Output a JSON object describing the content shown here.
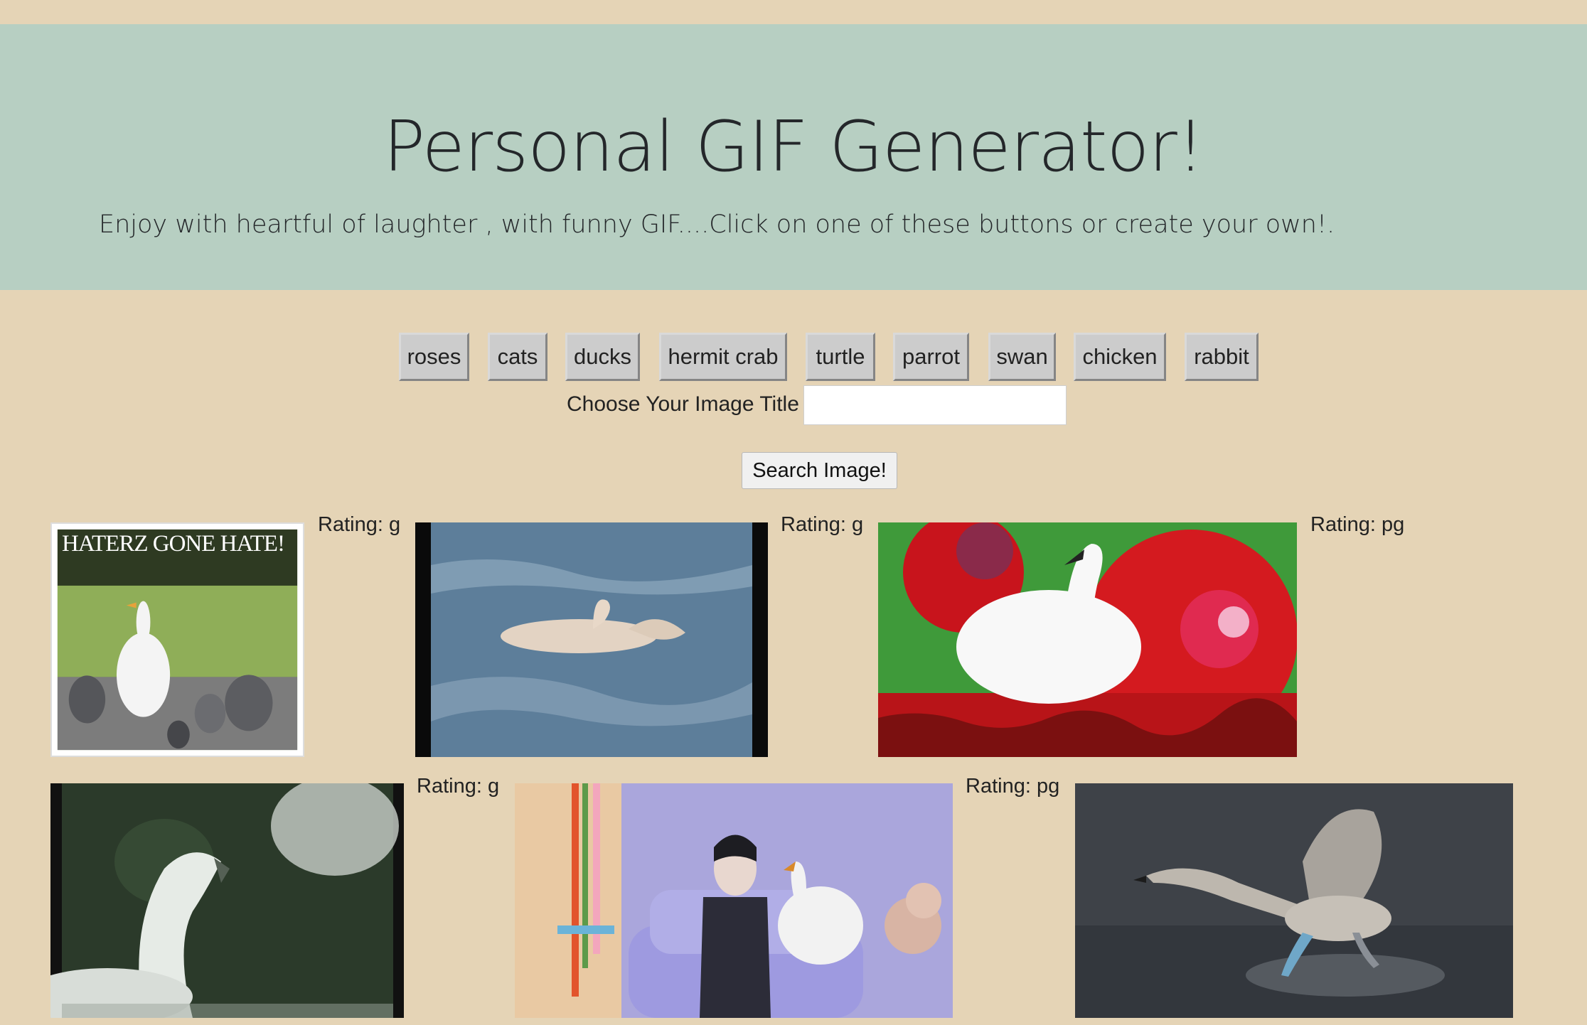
{
  "header": {
    "title": "Personal GIF Generator!",
    "subtitle": "Enjoy with heartful of laughter , with funny GIF....Click on one of these buttons or create your own!."
  },
  "topics": [
    "roses",
    "cats",
    "ducks",
    "hermit crab",
    "turtle",
    "parrot",
    "swan",
    "chicken",
    "rabbit"
  ],
  "form": {
    "label": "Choose Your Image Title",
    "value": "",
    "search_label": "Search Image!"
  },
  "gifs": [
    {
      "rating": "Rating: g",
      "caption": "HATERZ GONE HATE!",
      "subject": "goose chasing pigeons"
    },
    {
      "rating": "Rating: g",
      "subject": "swan bathing in water"
    },
    {
      "rating": "Rating: pg",
      "subject": "white swan among red roses"
    },
    {
      "rating": "Rating: g",
      "subject": "swan close-up"
    },
    {
      "rating": "Rating: pg",
      "subject": "woman on sofa holding swan"
    },
    {
      "rating": "",
      "subject": "swan landing on water"
    }
  ],
  "colors": {
    "page_background": "#e5d4b6",
    "header_background": "#b7cfc2",
    "button_background": "#cccccc"
  }
}
